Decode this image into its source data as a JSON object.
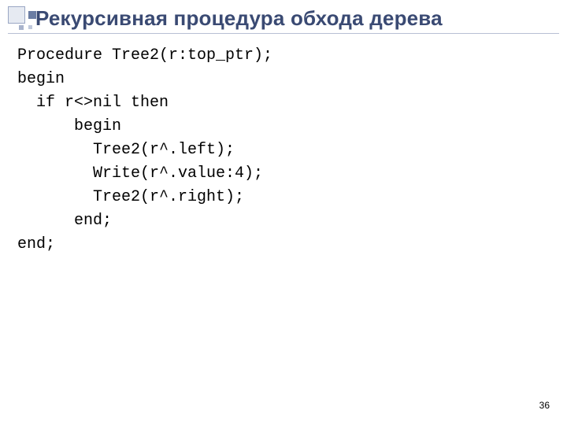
{
  "title": "Рекурсивная процедура обхода дерева",
  "code": {
    "l1": "Procedure Tree2(r:top_ptr);",
    "l2": "begin",
    "l3": "  if r<>nil then",
    "l4": "      begin",
    "l5": "        Tree2(r^.left);",
    "l6": "        Write(r^.value:4);",
    "l7": "        Tree2(r^.right);",
    "l8": "      end;",
    "l9": "end;"
  },
  "page_number": "36"
}
